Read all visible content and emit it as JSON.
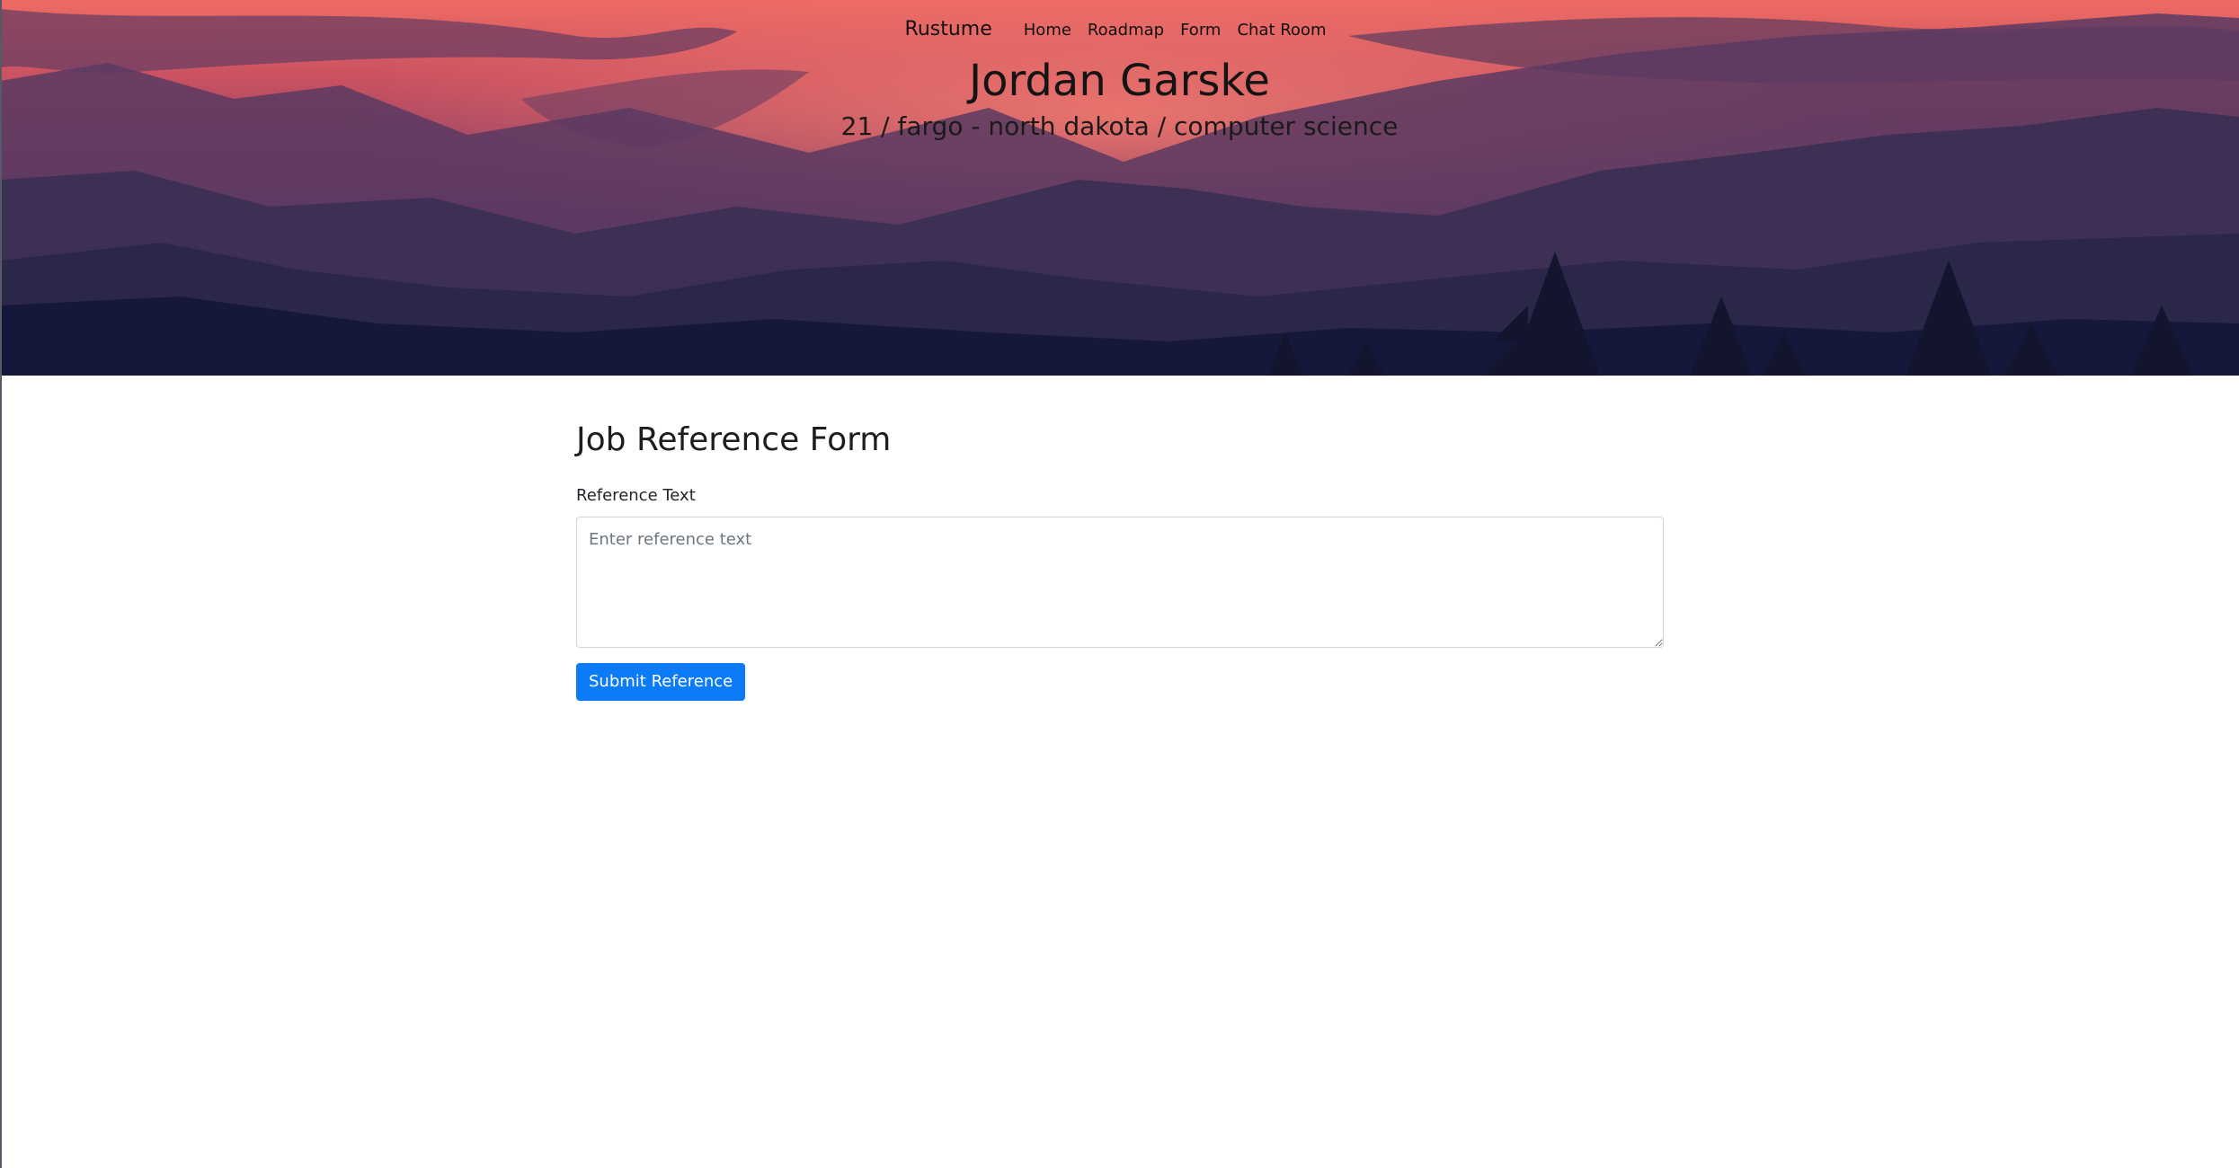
{
  "nav": {
    "brand": "Rustume",
    "links": [
      "Home",
      "Roadmap",
      "Form",
      "Chat Room"
    ]
  },
  "hero": {
    "title": "Jordan Garske",
    "subtitle": "21 / fargo - north dakota / computer science"
  },
  "form": {
    "heading": "Job Reference Form",
    "label": "Reference Text",
    "placeholder": "Enter reference text",
    "value": "",
    "submit_label": "Submit Reference"
  },
  "colors": {
    "accent": "#0b7bf7",
    "sky_top": "#ee6b63",
    "mountains_dark": "#1f1f3e"
  }
}
